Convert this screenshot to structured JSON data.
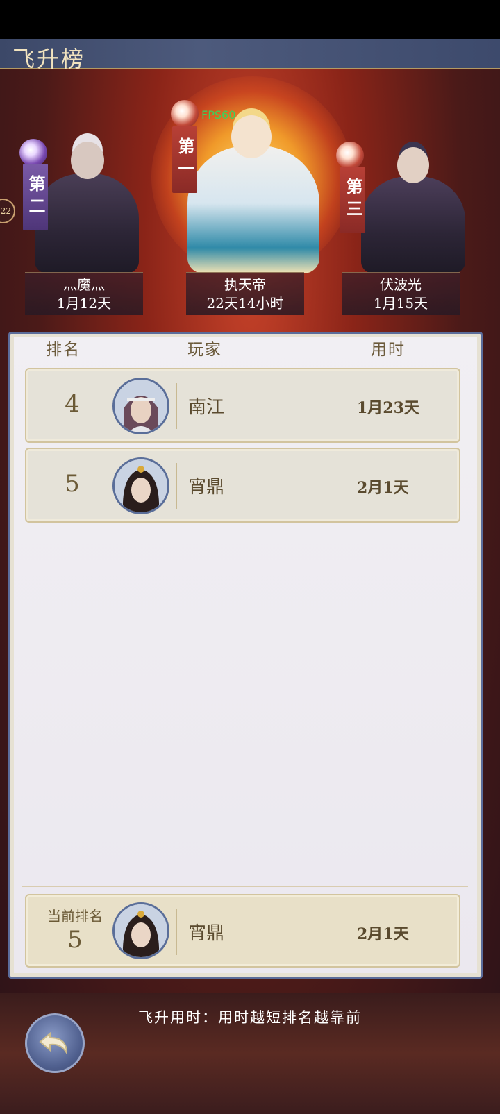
{
  "header": {
    "title": "飞升榜"
  },
  "overlay": {
    "fps": "FPS60",
    "side_chip": "22"
  },
  "top3": [
    {
      "ribbon": "第二",
      "name": "灬魔灬",
      "time": "1月12天"
    },
    {
      "ribbon": "第一",
      "name": "执天帝",
      "time": "22天14小时"
    },
    {
      "ribbon": "第三",
      "name": "伏波光",
      "time": "1月15天"
    }
  ],
  "table": {
    "columns": [
      "排名",
      "玩家",
      "用时"
    ],
    "rows": [
      {
        "rank": "4",
        "name": "南江",
        "time": "1月23天"
      },
      {
        "rank": "5",
        "name": "宵鼎",
        "time": "2月1天"
      }
    ]
  },
  "current": {
    "label": "当前排名",
    "rank": "5",
    "name": "宵鼎",
    "time": "2月1天"
  },
  "tip": "飞升用时：用时越短排名越靠前",
  "colors": {
    "accent_gold": "#b39a63",
    "panel_border": "#5b6c9a",
    "ribbon_purple": "#7a4ab2",
    "ribbon_red": "#a8382e"
  }
}
